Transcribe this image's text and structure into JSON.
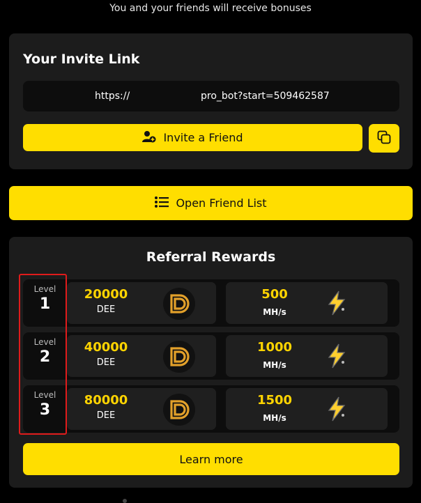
{
  "header": {
    "subtitle": "You and your friends will receive bonuses"
  },
  "invite": {
    "title": "Your Invite Link",
    "link_prefix": "https://",
    "link_suffix": "pro_bot?start=509462587",
    "invite_button": "Invite a Friend",
    "icons": {
      "invite": "add-user-icon",
      "copy": "copy-icon"
    }
  },
  "friends": {
    "open_list_button": "Open Friend List",
    "icon": "list-icon"
  },
  "rewards": {
    "title": "Referral Rewards",
    "level_label": "Level",
    "rows": [
      {
        "level": "1",
        "dee_amount": "20000",
        "dee_unit": "DEE",
        "hash_amount": "500",
        "hash_unit": "MH/s"
      },
      {
        "level": "2",
        "dee_amount": "40000",
        "dee_unit": "DEE",
        "hash_amount": "1000",
        "hash_unit": "MH/s"
      },
      {
        "level": "3",
        "dee_amount": "80000",
        "dee_unit": "DEE",
        "hash_amount": "1500",
        "hash_unit": "MH/s"
      }
    ],
    "learn_more": "Learn more",
    "icons": {
      "coin": "dee-coin-icon",
      "power": "lightning-icon"
    }
  },
  "colors": {
    "accent": "#ffde00",
    "card": "#1c1c1c",
    "highlight": "#e01b1b"
  }
}
